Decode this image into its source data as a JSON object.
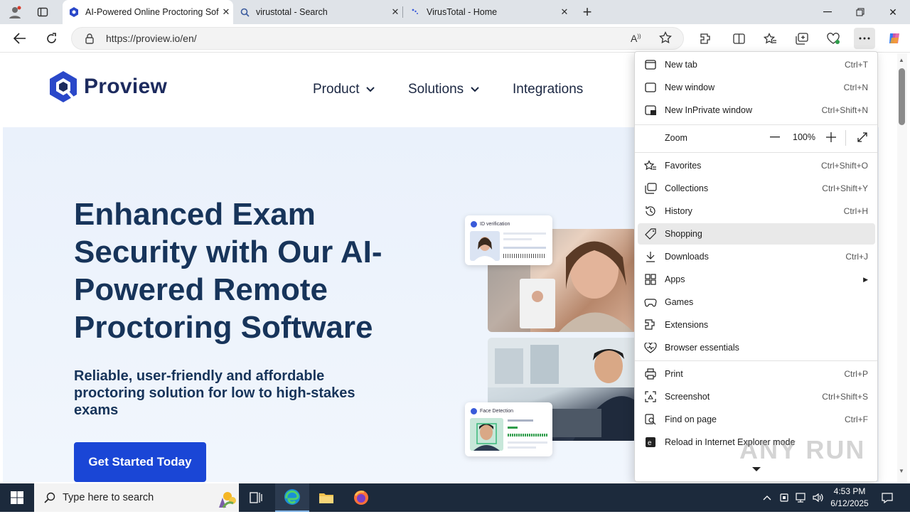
{
  "browser": {
    "tabs": [
      {
        "label": "AI-Powered Online Proctoring Sof",
        "active": true,
        "icon": "proview-icon"
      },
      {
        "label": "virustotal - Search",
        "active": false,
        "icon": "search-icon"
      },
      {
        "label": "VirusTotal - Home",
        "active": false,
        "icon": "virustotal-icon"
      }
    ],
    "url": "https://proview.io/en/"
  },
  "site": {
    "logo_text": "Proview",
    "nav": [
      "Product",
      "Solutions",
      "Integrations"
    ],
    "hero_title": "Enhanced Exam Security with Our AI-Powered Remote Proctoring Software",
    "hero_subtitle": "Reliable, user-friendly and affordable proctoring solution for low to high-stakes exams",
    "cta": "Get Started Today",
    "card_id": "ID verification",
    "card_face": "Face Detection"
  },
  "menu": {
    "items": [
      {
        "label": "New tab",
        "shortcut": "Ctrl+T",
        "icon": "new-tab-icon"
      },
      {
        "label": "New window",
        "shortcut": "Ctrl+N",
        "icon": "new-window-icon"
      },
      {
        "label": "New InPrivate window",
        "shortcut": "Ctrl+Shift+N",
        "icon": "inprivate-icon"
      },
      {
        "label": "Favorites",
        "shortcut": "Ctrl+Shift+O",
        "icon": "favorites-icon"
      },
      {
        "label": "Collections",
        "shortcut": "Ctrl+Shift+Y",
        "icon": "collections-icon"
      },
      {
        "label": "History",
        "shortcut": "Ctrl+H",
        "icon": "history-icon"
      },
      {
        "label": "Shopping",
        "shortcut": "",
        "icon": "shopping-icon"
      },
      {
        "label": "Downloads",
        "shortcut": "Ctrl+J",
        "icon": "downloads-icon"
      },
      {
        "label": "Apps",
        "shortcut": "",
        "icon": "apps-icon"
      },
      {
        "label": "Games",
        "shortcut": "",
        "icon": "games-icon"
      },
      {
        "label": "Extensions",
        "shortcut": "",
        "icon": "extensions-icon"
      },
      {
        "label": "Browser essentials",
        "shortcut": "",
        "icon": "browser-essentials-icon"
      },
      {
        "label": "Print",
        "shortcut": "Ctrl+P",
        "icon": "print-icon"
      },
      {
        "label": "Screenshot",
        "shortcut": "Ctrl+Shift+S",
        "icon": "screenshot-icon"
      },
      {
        "label": "Find on page",
        "shortcut": "Ctrl+F",
        "icon": "find-icon"
      },
      {
        "label": "Reload in Internet Explorer mode",
        "shortcut": "",
        "icon": "ie-mode-icon"
      }
    ],
    "zoom_label": "Zoom",
    "zoom_value": "100%",
    "hovered": "Shopping"
  },
  "taskbar": {
    "search_placeholder": "Type here to search",
    "time": "4:53 PM",
    "date": "6/12/2025"
  },
  "watermark": "ANY RUN"
}
